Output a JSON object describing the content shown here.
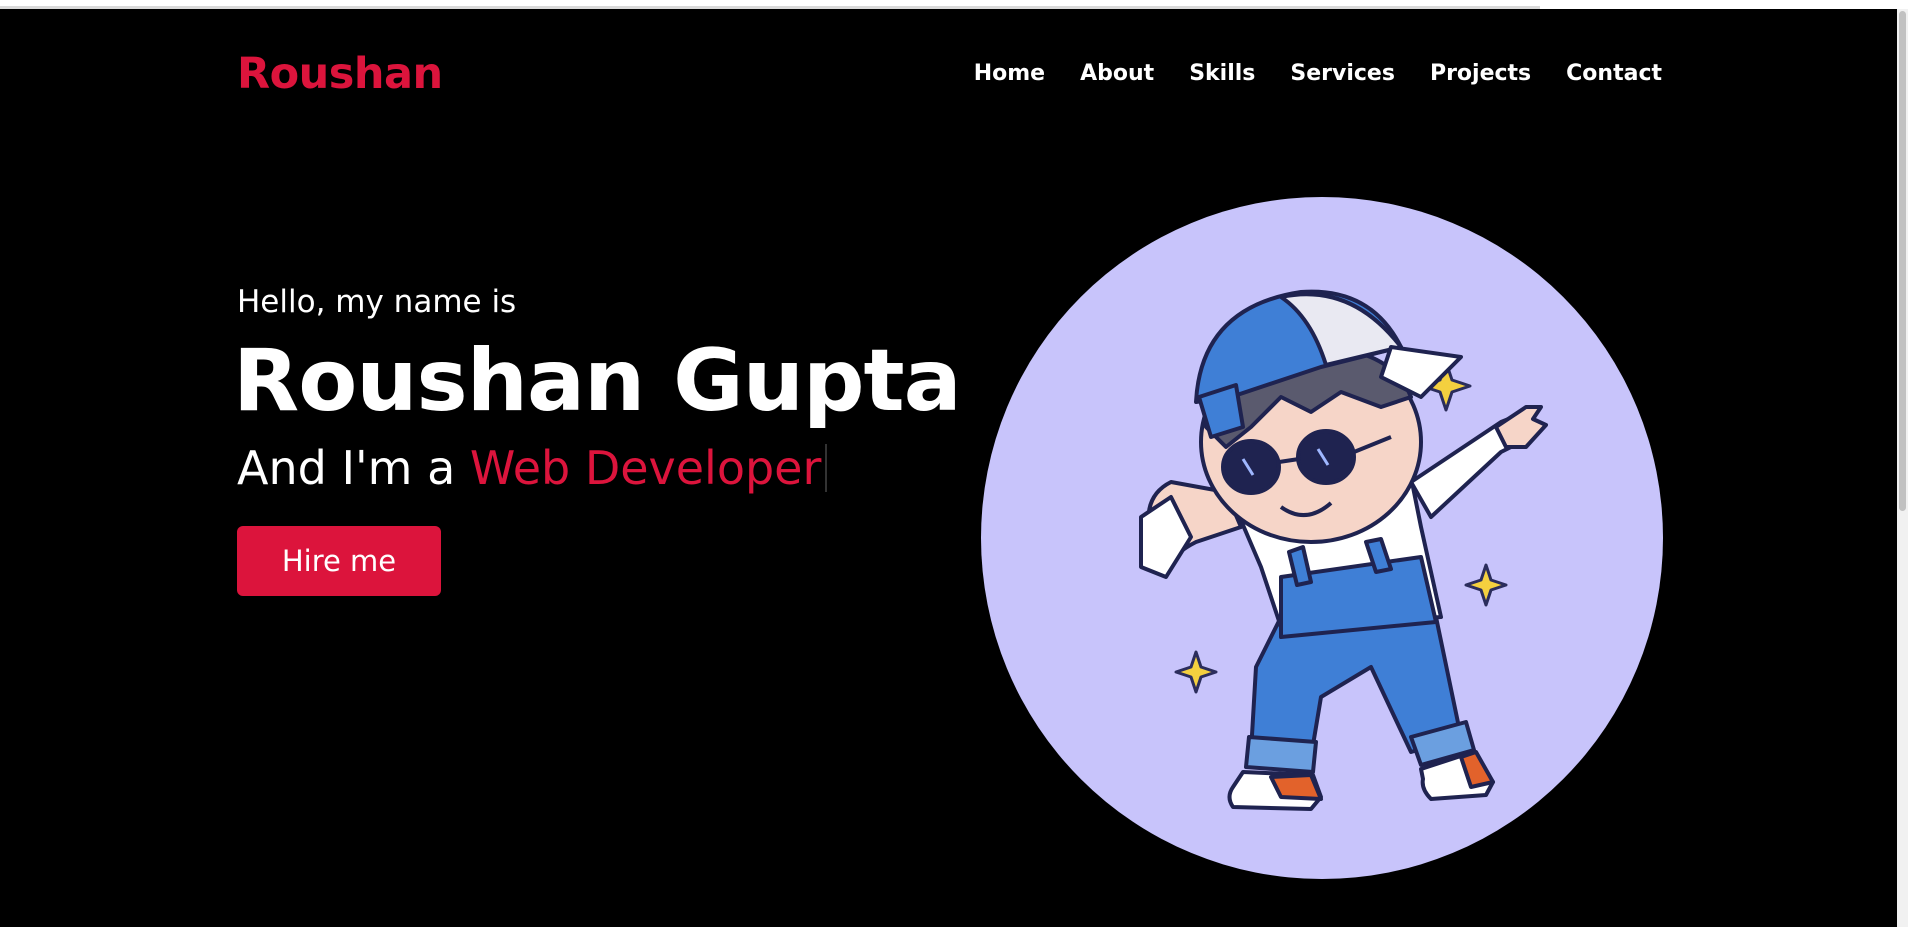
{
  "header": {
    "logo": "Roushan",
    "nav": [
      "Home",
      "About",
      "Skills",
      "Services",
      "Projects",
      "Contact"
    ]
  },
  "hero": {
    "greeting": "Hello, my name is",
    "name": "Roushan Gupta",
    "role_prefix": "And I'm a ",
    "role": "Web Developer",
    "cta_label": "Hire me"
  },
  "colors": {
    "accent": "#dc143c",
    "background": "#000000",
    "text": "#ffffff",
    "avatar_bg": "#c8c4fb"
  },
  "avatar": {
    "icon": "dabbing-boy-illustration"
  }
}
